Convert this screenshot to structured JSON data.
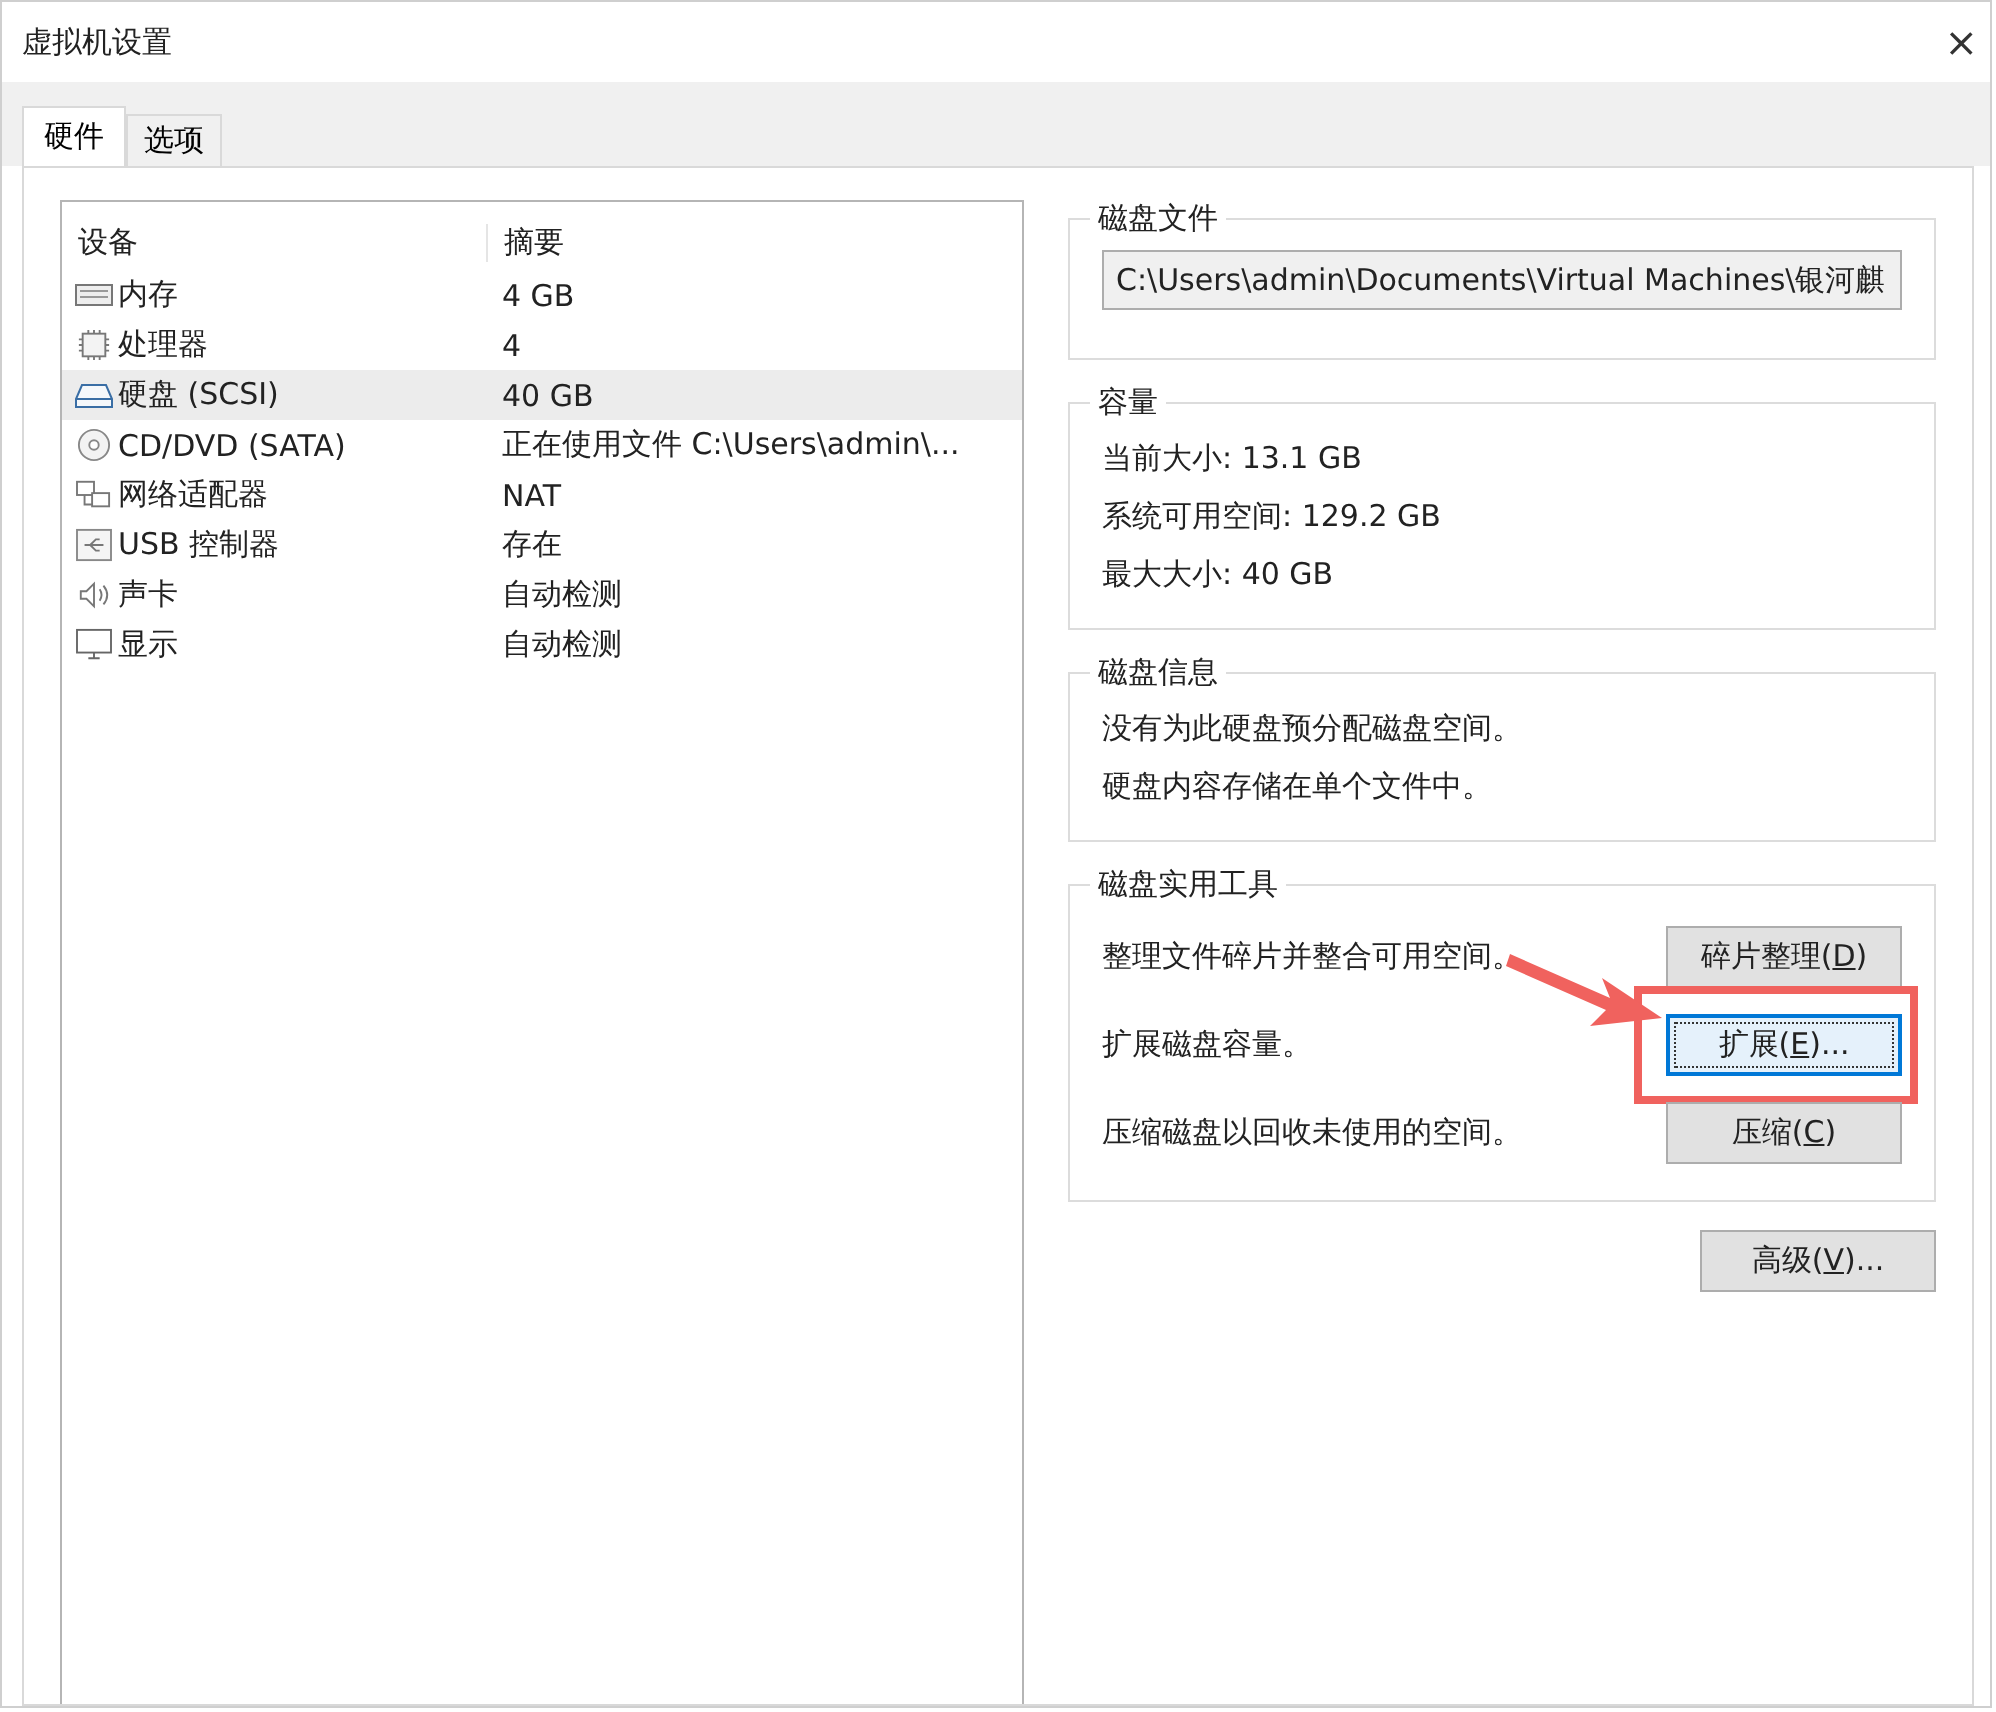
{
  "window": {
    "title": "虚拟机设置",
    "close": "×"
  },
  "tabs": [
    {
      "label": "硬件",
      "selected": true
    },
    {
      "label": "选项",
      "selected": false
    }
  ],
  "devices": {
    "columns": [
      "设备",
      "摘要"
    ],
    "rows": [
      {
        "kind": "memory",
        "name": "内存",
        "summary": "4 GB",
        "selected": false
      },
      {
        "kind": "cpu",
        "name": "处理器",
        "summary": "4",
        "selected": false
      },
      {
        "kind": "disk",
        "name": "硬盘 (SCSI)",
        "summary": "40 GB",
        "selected": true
      },
      {
        "kind": "cd",
        "name": "CD/DVD (SATA)",
        "summary": "正在使用文件 C:\\Users\\admin\\...",
        "selected": false
      },
      {
        "kind": "network",
        "name": "网络适配器",
        "summary": "NAT",
        "selected": false
      },
      {
        "kind": "usb",
        "name": "USB 控制器",
        "summary": "存在",
        "selected": false
      },
      {
        "kind": "sound",
        "name": "声卡",
        "summary": "自动检测",
        "selected": false
      },
      {
        "kind": "display",
        "name": "显示",
        "summary": "自动检测",
        "selected": false
      }
    ]
  },
  "disk_file": {
    "title": "磁盘文件",
    "value": "C:\\Users\\admin\\Documents\\Virtual Machines\\银河麒"
  },
  "capacity": {
    "title": "容量",
    "lines": [
      "当前大小: 13.1 GB",
      "系统可用空间: 129.2 GB",
      "最大大小: 40 GB"
    ]
  },
  "disk_info": {
    "title": "磁盘信息",
    "lines": [
      "没有为此硬盘预分配磁盘空间。",
      "硬盘内容存储在单个文件中。"
    ]
  },
  "utilities": {
    "title": "磁盘实用工具",
    "rows": [
      {
        "text": "整理文件碎片并整合可用空间。",
        "button": [
          "碎片整理(",
          "D",
          ")"
        ],
        "focused": false,
        "highlighted": false
      },
      {
        "text": "扩展磁盘容量。",
        "button": [
          "扩展(",
          "E",
          ")..."
        ],
        "focused": true,
        "highlighted": true
      },
      {
        "text": "压缩磁盘以回收未使用的空间。",
        "button": [
          "压缩(",
          "C",
          ")"
        ],
        "focused": false,
        "highlighted": false
      }
    ]
  },
  "advanced_button": [
    "高级(",
    "V",
    ")..."
  ]
}
